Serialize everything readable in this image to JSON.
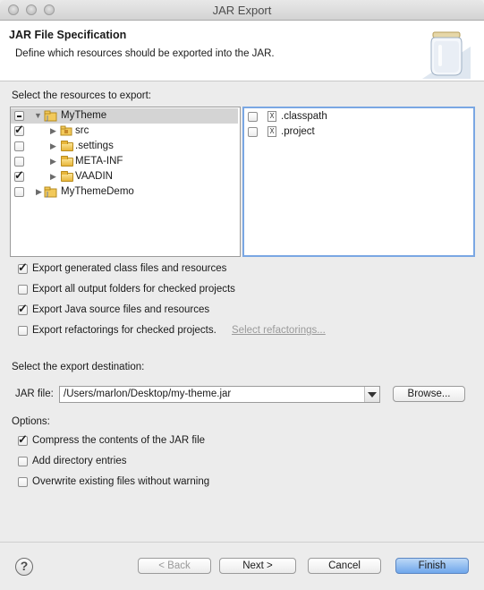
{
  "window": {
    "title": "JAR Export"
  },
  "header": {
    "title": "JAR File Specification",
    "description": "Define which resources should be exported into the JAR.",
    "icon": "jar-icon"
  },
  "resources": {
    "label": "Select the resources to export:",
    "tree": [
      {
        "label": "MyTheme",
        "state": "partial",
        "expanded": true,
        "icon": "project-icon",
        "selected": true
      },
      {
        "label": "src",
        "state": "checked",
        "icon": "package-folder-icon"
      },
      {
        "label": ".settings",
        "state": "unchecked",
        "icon": "folder-icon"
      },
      {
        "label": "META-INF",
        "state": "unchecked",
        "icon": "folder-icon"
      },
      {
        "label": "VAADIN",
        "state": "checked",
        "icon": "folder-icon"
      },
      {
        "label": "MyThemeDemo",
        "state": "unchecked",
        "icon": "project-icon"
      }
    ],
    "files": [
      {
        "label": ".classpath",
        "state": "unchecked",
        "icon": "xml-file-icon"
      },
      {
        "label": ".project",
        "state": "unchecked",
        "icon": "xml-file-icon"
      }
    ]
  },
  "export_options": [
    {
      "label": "Export generated class files and resources",
      "checked": true
    },
    {
      "label": "Export all output folders for checked projects",
      "checked": false
    },
    {
      "label": "Export Java source files and resources",
      "checked": true
    },
    {
      "label": "Export refactorings for checked projects.",
      "checked": false,
      "link": "Select refactorings..."
    }
  ],
  "destination": {
    "label": "Select the export destination:",
    "jar_label": "JAR file:",
    "jar_value": "/Users/marlon/Desktop/my-theme.jar",
    "browse_label": "Browse..."
  },
  "options": {
    "label": "Options:",
    "items": [
      {
        "label": "Compress the contents of the JAR file",
        "checked": true
      },
      {
        "label": "Add directory entries",
        "checked": false
      },
      {
        "label": "Overwrite existing files without warning",
        "checked": false
      }
    ]
  },
  "footer": {
    "help": "?",
    "back": "< Back",
    "next": "Next >",
    "cancel": "Cancel",
    "finish": "Finish"
  }
}
